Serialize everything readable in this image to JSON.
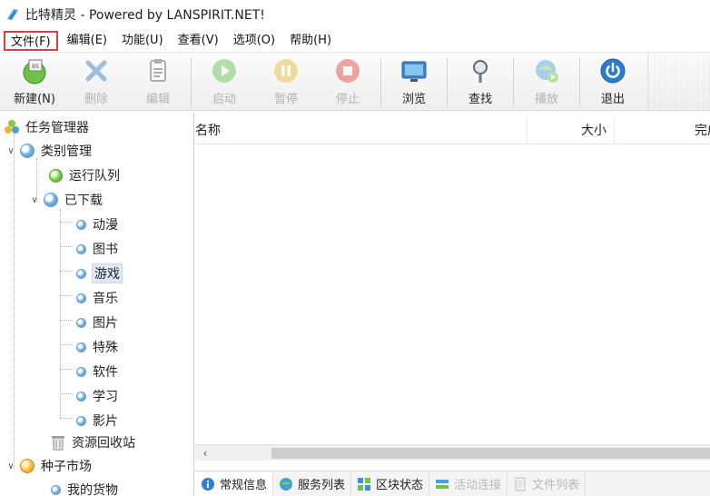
{
  "window": {
    "title": "比特精灵 - Powered by LANSPIRIT.NET!"
  },
  "menu": [
    {
      "label": "文件(F)",
      "active": true
    },
    {
      "label": "编辑(E)"
    },
    {
      "label": "功能(U)"
    },
    {
      "label": "查看(V)"
    },
    {
      "label": "选项(O)"
    },
    {
      "label": "帮助(H)"
    }
  ],
  "toolbar": [
    {
      "label": "新建(N)",
      "icon": "new-task-icon",
      "enabled": true
    },
    {
      "label": "删除",
      "icon": "delete-icon",
      "enabled": false
    },
    {
      "label": "编辑",
      "icon": "edit-icon",
      "enabled": false
    },
    {
      "label": "启动",
      "icon": "start-icon",
      "enabled": false
    },
    {
      "label": "暂停",
      "icon": "pause-icon",
      "enabled": false
    },
    {
      "label": "停止",
      "icon": "stop-icon",
      "enabled": false
    },
    {
      "label": "浏览",
      "icon": "browse-icon",
      "enabled": true
    },
    {
      "label": "查找",
      "icon": "search-icon",
      "enabled": true
    },
    {
      "label": "播放",
      "icon": "play-icon",
      "enabled": false
    },
    {
      "label": "退出",
      "icon": "power-icon",
      "enabled": true
    }
  ],
  "tree": {
    "root": "任务管理器",
    "category": "类别管理",
    "queue": "运行队列",
    "downloaded": "已下载",
    "children": [
      "动漫",
      "图书",
      "游戏",
      "音乐",
      "图片",
      "特殊",
      "软件",
      "学习",
      "影片"
    ],
    "selected": "游戏",
    "recycle": "资源回收站",
    "market": "种子市场",
    "my_goods": "我的货物"
  },
  "list": {
    "columns": [
      "名称",
      "大小",
      "完成量"
    ]
  },
  "bottom_tabs": [
    {
      "label": "常规信息",
      "icon": "info-icon",
      "active": true
    },
    {
      "label": "服务列表",
      "icon": "server-icon"
    },
    {
      "label": "区块状态",
      "icon": "blocks-icon"
    },
    {
      "label": "活动连接",
      "icon": "connection-icon",
      "dim": true
    },
    {
      "label": "文件列表",
      "icon": "file-list-icon",
      "dim": true
    }
  ],
  "colors": {
    "menu_highlight": "#d9413b",
    "selection": "#dfe9f5"
  }
}
